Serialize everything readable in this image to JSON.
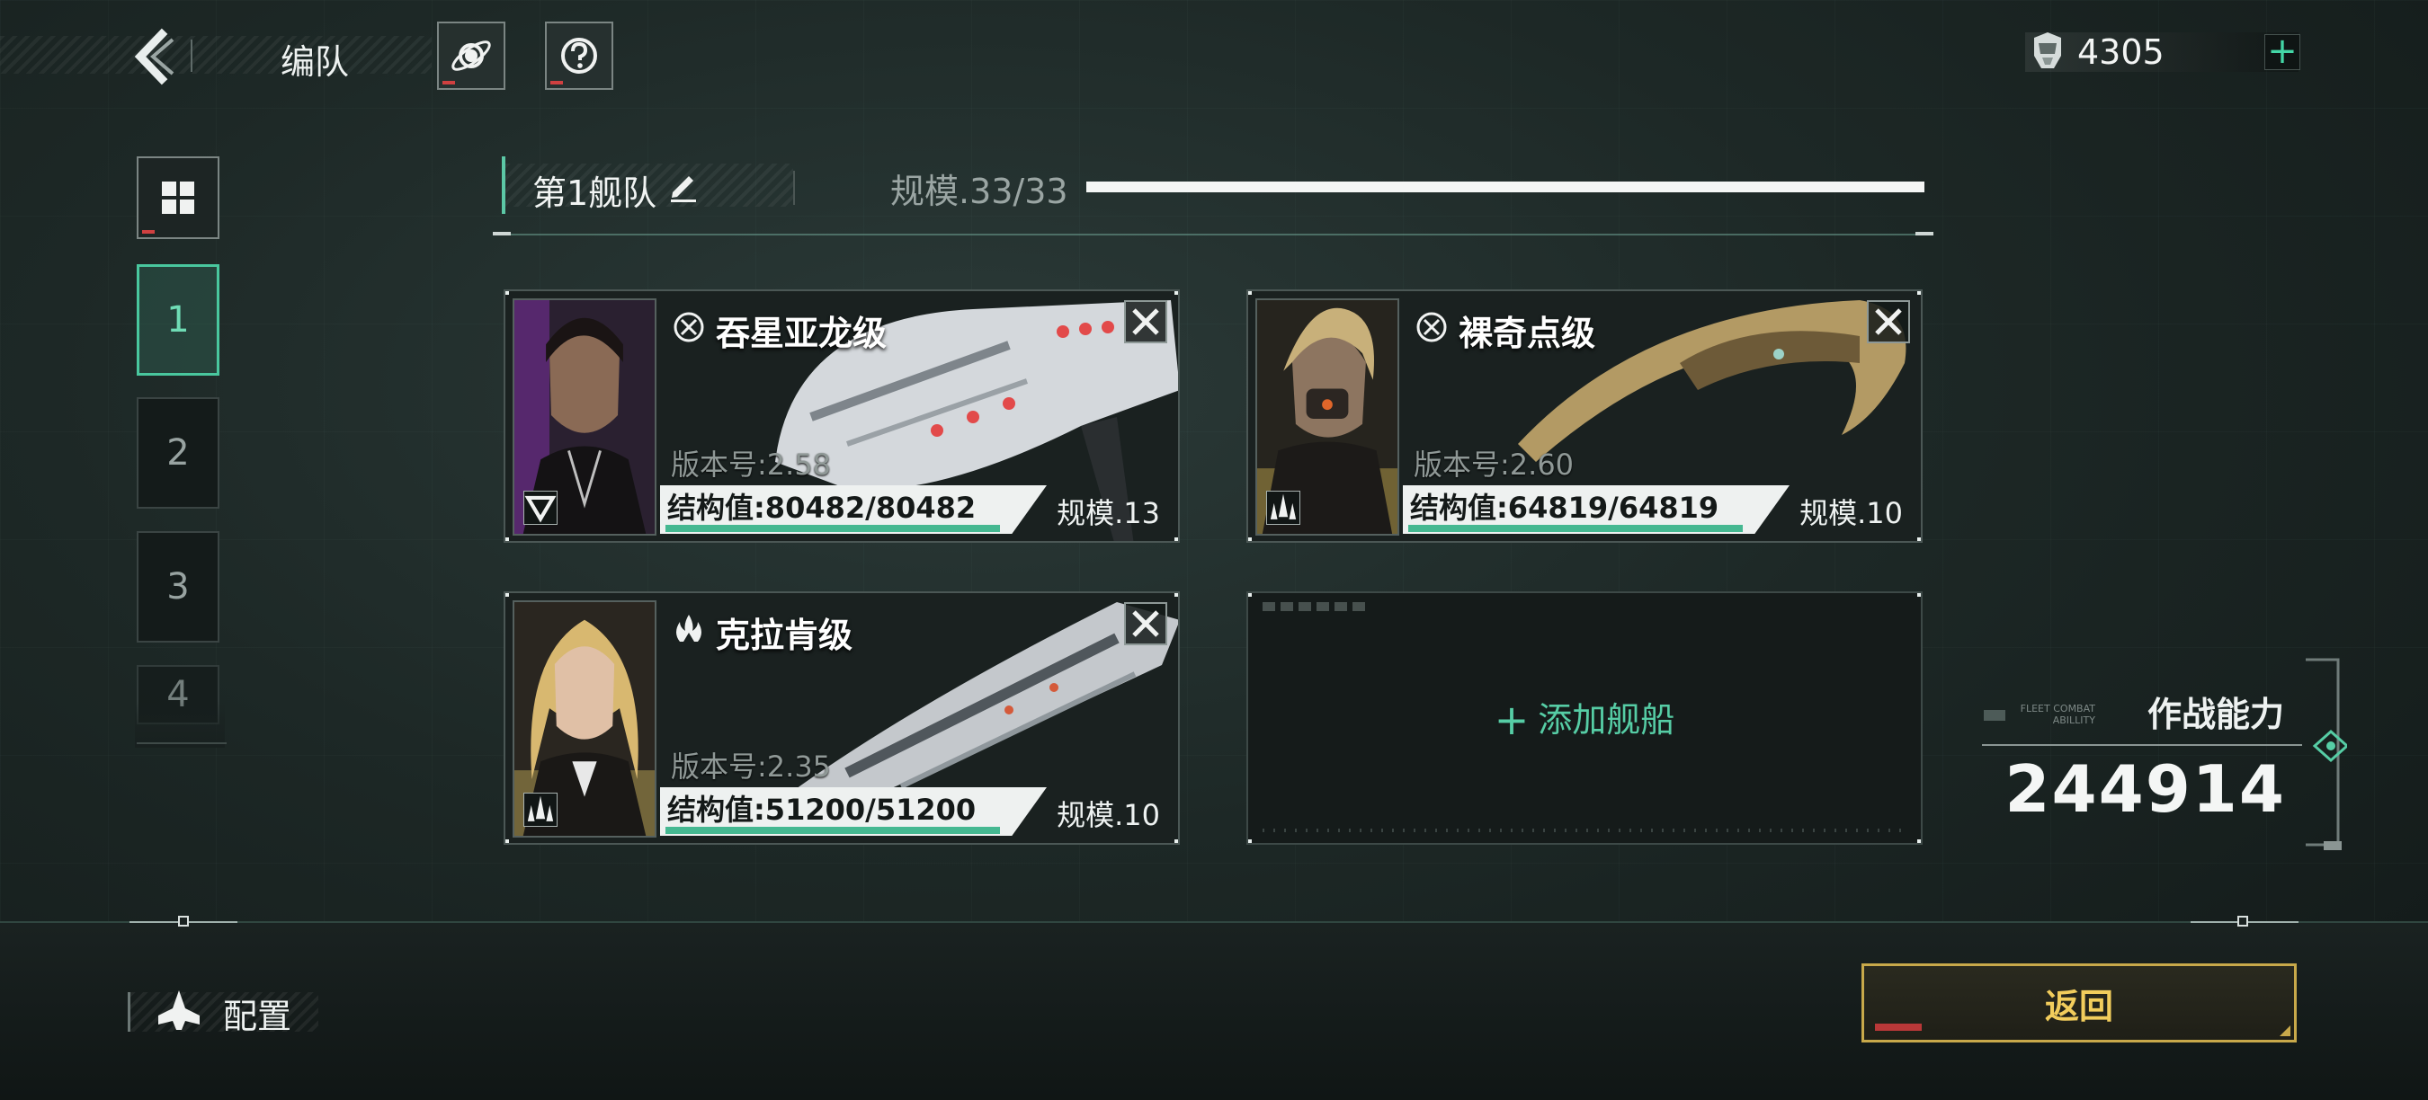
{
  "header": {
    "title": "编队",
    "currency_value": "4305",
    "plus_label": "+"
  },
  "tabs": [
    {
      "label": "1",
      "active": true
    },
    {
      "label": "2",
      "active": false
    },
    {
      "label": "3",
      "active": false
    },
    {
      "label": "4",
      "active": false
    }
  ],
  "fleet": {
    "name": "第1舰队",
    "scale_label": "规模.33/33",
    "scale_current": 33,
    "scale_max": 33
  },
  "ships": [
    {
      "name": "吞星亚龙级",
      "version": "版本号:2.58",
      "structure": "结构值:80482/80482",
      "structure_fraction": 1.0,
      "scale": "规模.13",
      "class_icon": "target-icon",
      "tag_icon": "triangle-icon",
      "portrait_tint": "#7a2fa0"
    },
    {
      "name": "裸奇点级",
      "version": "版本号:2.60",
      "structure": "结构值:64819/64819",
      "structure_fraction": 1.0,
      "scale": "规模.10",
      "class_icon": "target-icon",
      "tag_icon": "fighters-icon",
      "portrait_tint": "#b9a04a"
    },
    {
      "name": "克拉肯级",
      "version": "版本号:2.35",
      "structure": "结构值:51200/51200",
      "structure_fraction": 1.0,
      "scale": "规模.10",
      "class_icon": "flame-icon",
      "tag_icon": "fighters-icon",
      "portrait_tint": "#c9b45a"
    }
  ],
  "empty_slot": {
    "label": "添加舰船",
    "plus": "+"
  },
  "combat_power": {
    "label": "作战能力",
    "small_label": "FLEET COMBAT ABILLITY",
    "value": "244914"
  },
  "bottom": {
    "config_label": "配置",
    "return_label": "返回"
  },
  "colors": {
    "accent": "#49c79e",
    "gold": "#c8a94a"
  }
}
